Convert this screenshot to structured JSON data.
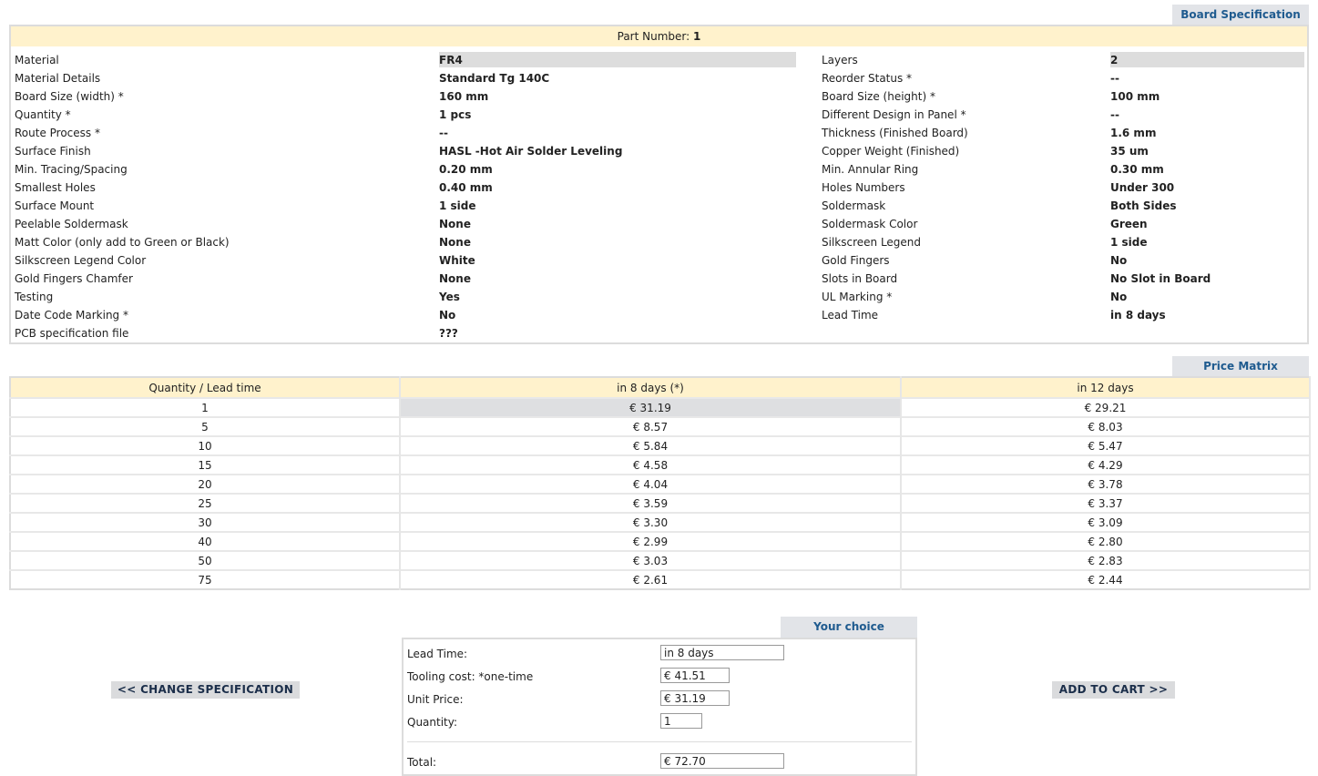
{
  "tabs": {
    "board_spec": "Board Specification",
    "price_matrix": "Price Matrix",
    "your_choice": "Your choice"
  },
  "part": {
    "label": "Part Number:",
    "value": "1"
  },
  "spec": [
    {
      "l1": "Material",
      "v1": "FR4",
      "l2": "Layers",
      "v2": "2"
    },
    {
      "l1": "Material Details",
      "v1": "Standard Tg 140C",
      "l2": "Reorder Status *",
      "v2": "--"
    },
    {
      "l1": "Board Size (width) *",
      "v1": "160 mm",
      "l2": "Board Size (height) *",
      "v2": "100 mm"
    },
    {
      "l1": "Quantity *",
      "v1": "1 pcs",
      "l2": "Different Design in Panel *",
      "v2": "--"
    },
    {
      "l1": "Route Process *",
      "v1": "--",
      "l2": "Thickness (Finished Board)",
      "v2": "1.6 mm"
    },
    {
      "l1": "Surface Finish",
      "v1": "HASL -Hot Air Solder Leveling",
      "l2": "Copper Weight (Finished)",
      "v2": "35 um"
    },
    {
      "l1": "Min. Tracing/Spacing",
      "v1": "0.20 mm",
      "l2": "Min. Annular Ring",
      "v2": "0.30 mm"
    },
    {
      "l1": "Smallest Holes",
      "v1": "0.40 mm",
      "l2": "Holes Numbers",
      "v2": "Under 300"
    },
    {
      "l1": "Surface Mount",
      "v1": "1 side",
      "l2": "Soldermask",
      "v2": "Both Sides"
    },
    {
      "l1": "Peelable Soldermask",
      "v1": "None",
      "l2": "Soldermask Color",
      "v2": "Green"
    },
    {
      "l1": "Matt Color (only add to Green or Black)",
      "v1": "None",
      "l2": "Silkscreen Legend",
      "v2": "1 side"
    },
    {
      "l1": "Silkscreen Legend Color",
      "v1": "White",
      "l2": "Gold Fingers",
      "v2": "No"
    },
    {
      "l1": "Gold Fingers Chamfer",
      "v1": "None",
      "l2": "Slots in Board",
      "v2": "No Slot in Board"
    },
    {
      "l1": "Testing",
      "v1": "Yes",
      "l2": "UL Marking *",
      "v2": "No"
    },
    {
      "l1": "Date Code Marking *",
      "v1": "No",
      "l2": "Lead Time",
      "v2": "in 8 days"
    },
    {
      "l1": "PCB specification file",
      "v1": "???",
      "l2": "",
      "v2": ""
    }
  ],
  "price_matrix": {
    "headers": [
      "Quantity / Lead time",
      "in 8 days (*)",
      "in 12 days"
    ],
    "rows": [
      [
        "1",
        "€ 31.19",
        "€ 29.21"
      ],
      [
        "5",
        "€ 8.57",
        "€ 8.03"
      ],
      [
        "10",
        "€ 5.84",
        "€ 5.47"
      ],
      [
        "15",
        "€ 4.58",
        "€ 4.29"
      ],
      [
        "20",
        "€ 4.04",
        "€ 3.78"
      ],
      [
        "25",
        "€ 3.59",
        "€ 3.37"
      ],
      [
        "30",
        "€ 3.30",
        "€ 3.09"
      ],
      [
        "40",
        "€ 2.99",
        "€ 2.80"
      ],
      [
        "50",
        "€ 3.03",
        "€ 2.83"
      ],
      [
        "75",
        "€ 2.61",
        "€ 2.44"
      ]
    ]
  },
  "choice": {
    "lead_time_label": "Lead Time:",
    "lead_time_value": "in 8 days",
    "tooling_label": "Tooling cost: *one-time",
    "tooling_value": "€ 41.51",
    "unit_price_label": "Unit Price:",
    "unit_price_value": "€ 31.19",
    "quantity_label": "Quantity:",
    "quantity_value": "1",
    "total_label": "Total:",
    "total_value": "€ 72.70"
  },
  "buttons": {
    "change_spec": "<< CHANGE SPECIFICATION",
    "add_to_cart": "ADD TO CART >>"
  },
  "colors": {
    "accent_tab_text": "#1f5b8f",
    "header_bg": "#fff2cc",
    "tab_bg": "#e2e4e8"
  }
}
